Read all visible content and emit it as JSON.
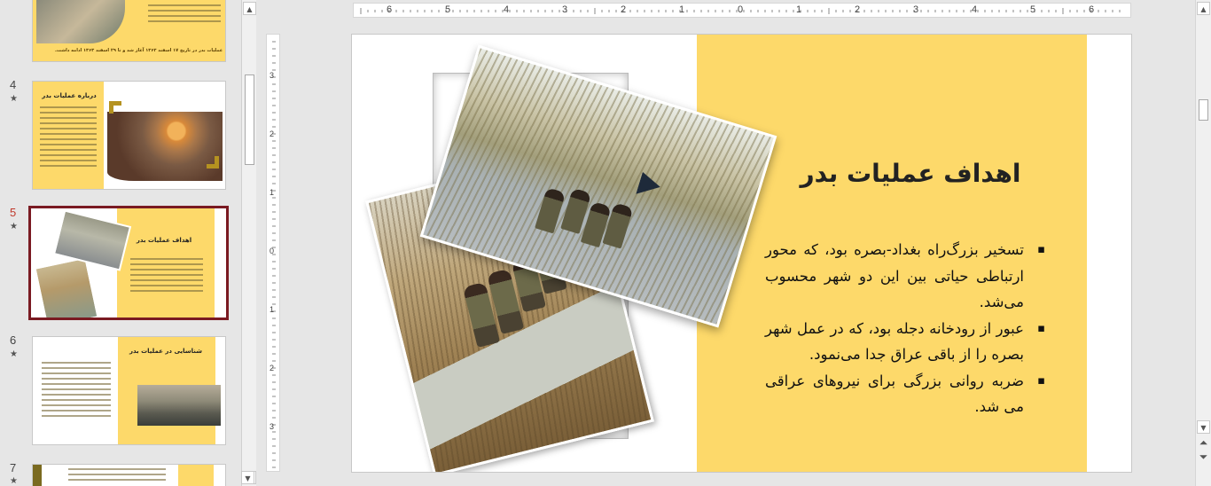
{
  "thumbnails": [
    {
      "number": "",
      "caption": "عملیات بدر در تاریخ ۱۷ اسفند ۱۳۶۳ آغاز شد و تا ۲۹ اسفند ۱۳۶۳ ادامه داشت."
    },
    {
      "number": "4",
      "star": "★",
      "title": "درباره عملیات بدر"
    },
    {
      "number": "5",
      "star": "★",
      "title": "اهداف عملیات بدر"
    },
    {
      "number": "6",
      "star": "★",
      "title": "شناسایی در عملیات بدر"
    },
    {
      "number": "7",
      "star": "★"
    }
  ],
  "ruler": {
    "top_labels": [
      "6",
      "5",
      "4",
      "3",
      "2",
      "1",
      "0",
      "1",
      "2",
      "3",
      "4",
      "5",
      "6"
    ],
    "left_labels": [
      "3",
      "2",
      "1",
      "0",
      "1",
      "2",
      "3"
    ]
  },
  "slide": {
    "title": "اهداف عملیات بدر",
    "bullets": [
      "تسخیر بزرگ‌راه بغداد-بصره بود، که محور ارتباطی حیاتی بین این دو شهر محسوب می‌شد.",
      "عبور از رودخانه دجله بود، که در عمل شهر بصره را از باقی عراق جدا می‌نمود.",
      "ضربه روانی بزرگی برای نیروهای عراقی می شد."
    ],
    "panel_color": "#fdd96a"
  },
  "scroll": {
    "up": "▲",
    "down": "▼",
    "prev": "⏶",
    "next": "⏷"
  },
  "colors": {
    "active_border": "#7a1a22",
    "active_number": "#c0392b"
  }
}
